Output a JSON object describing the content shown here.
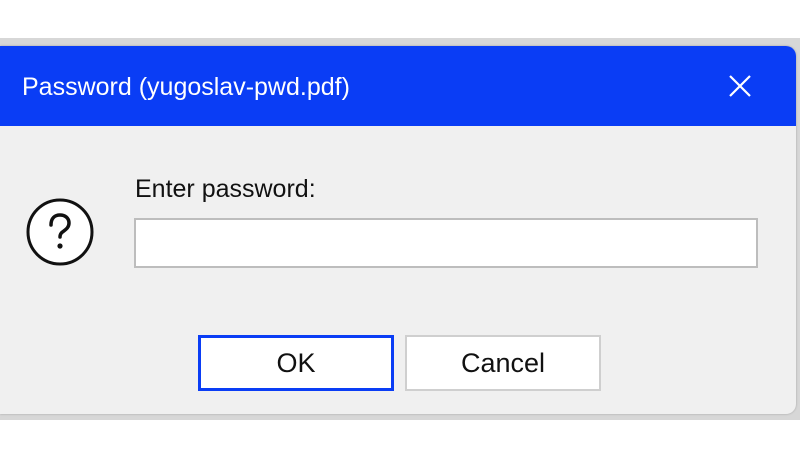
{
  "window": {
    "title": "Password (yugoslav-pwd.pdf)",
    "close_icon": "close-icon",
    "titlebar_color": "#0a3df5"
  },
  "dialog": {
    "icon": "question-icon",
    "prompt": "Enter password:",
    "password_value": "",
    "ok_label": "OK",
    "cancel_label": "Cancel"
  }
}
